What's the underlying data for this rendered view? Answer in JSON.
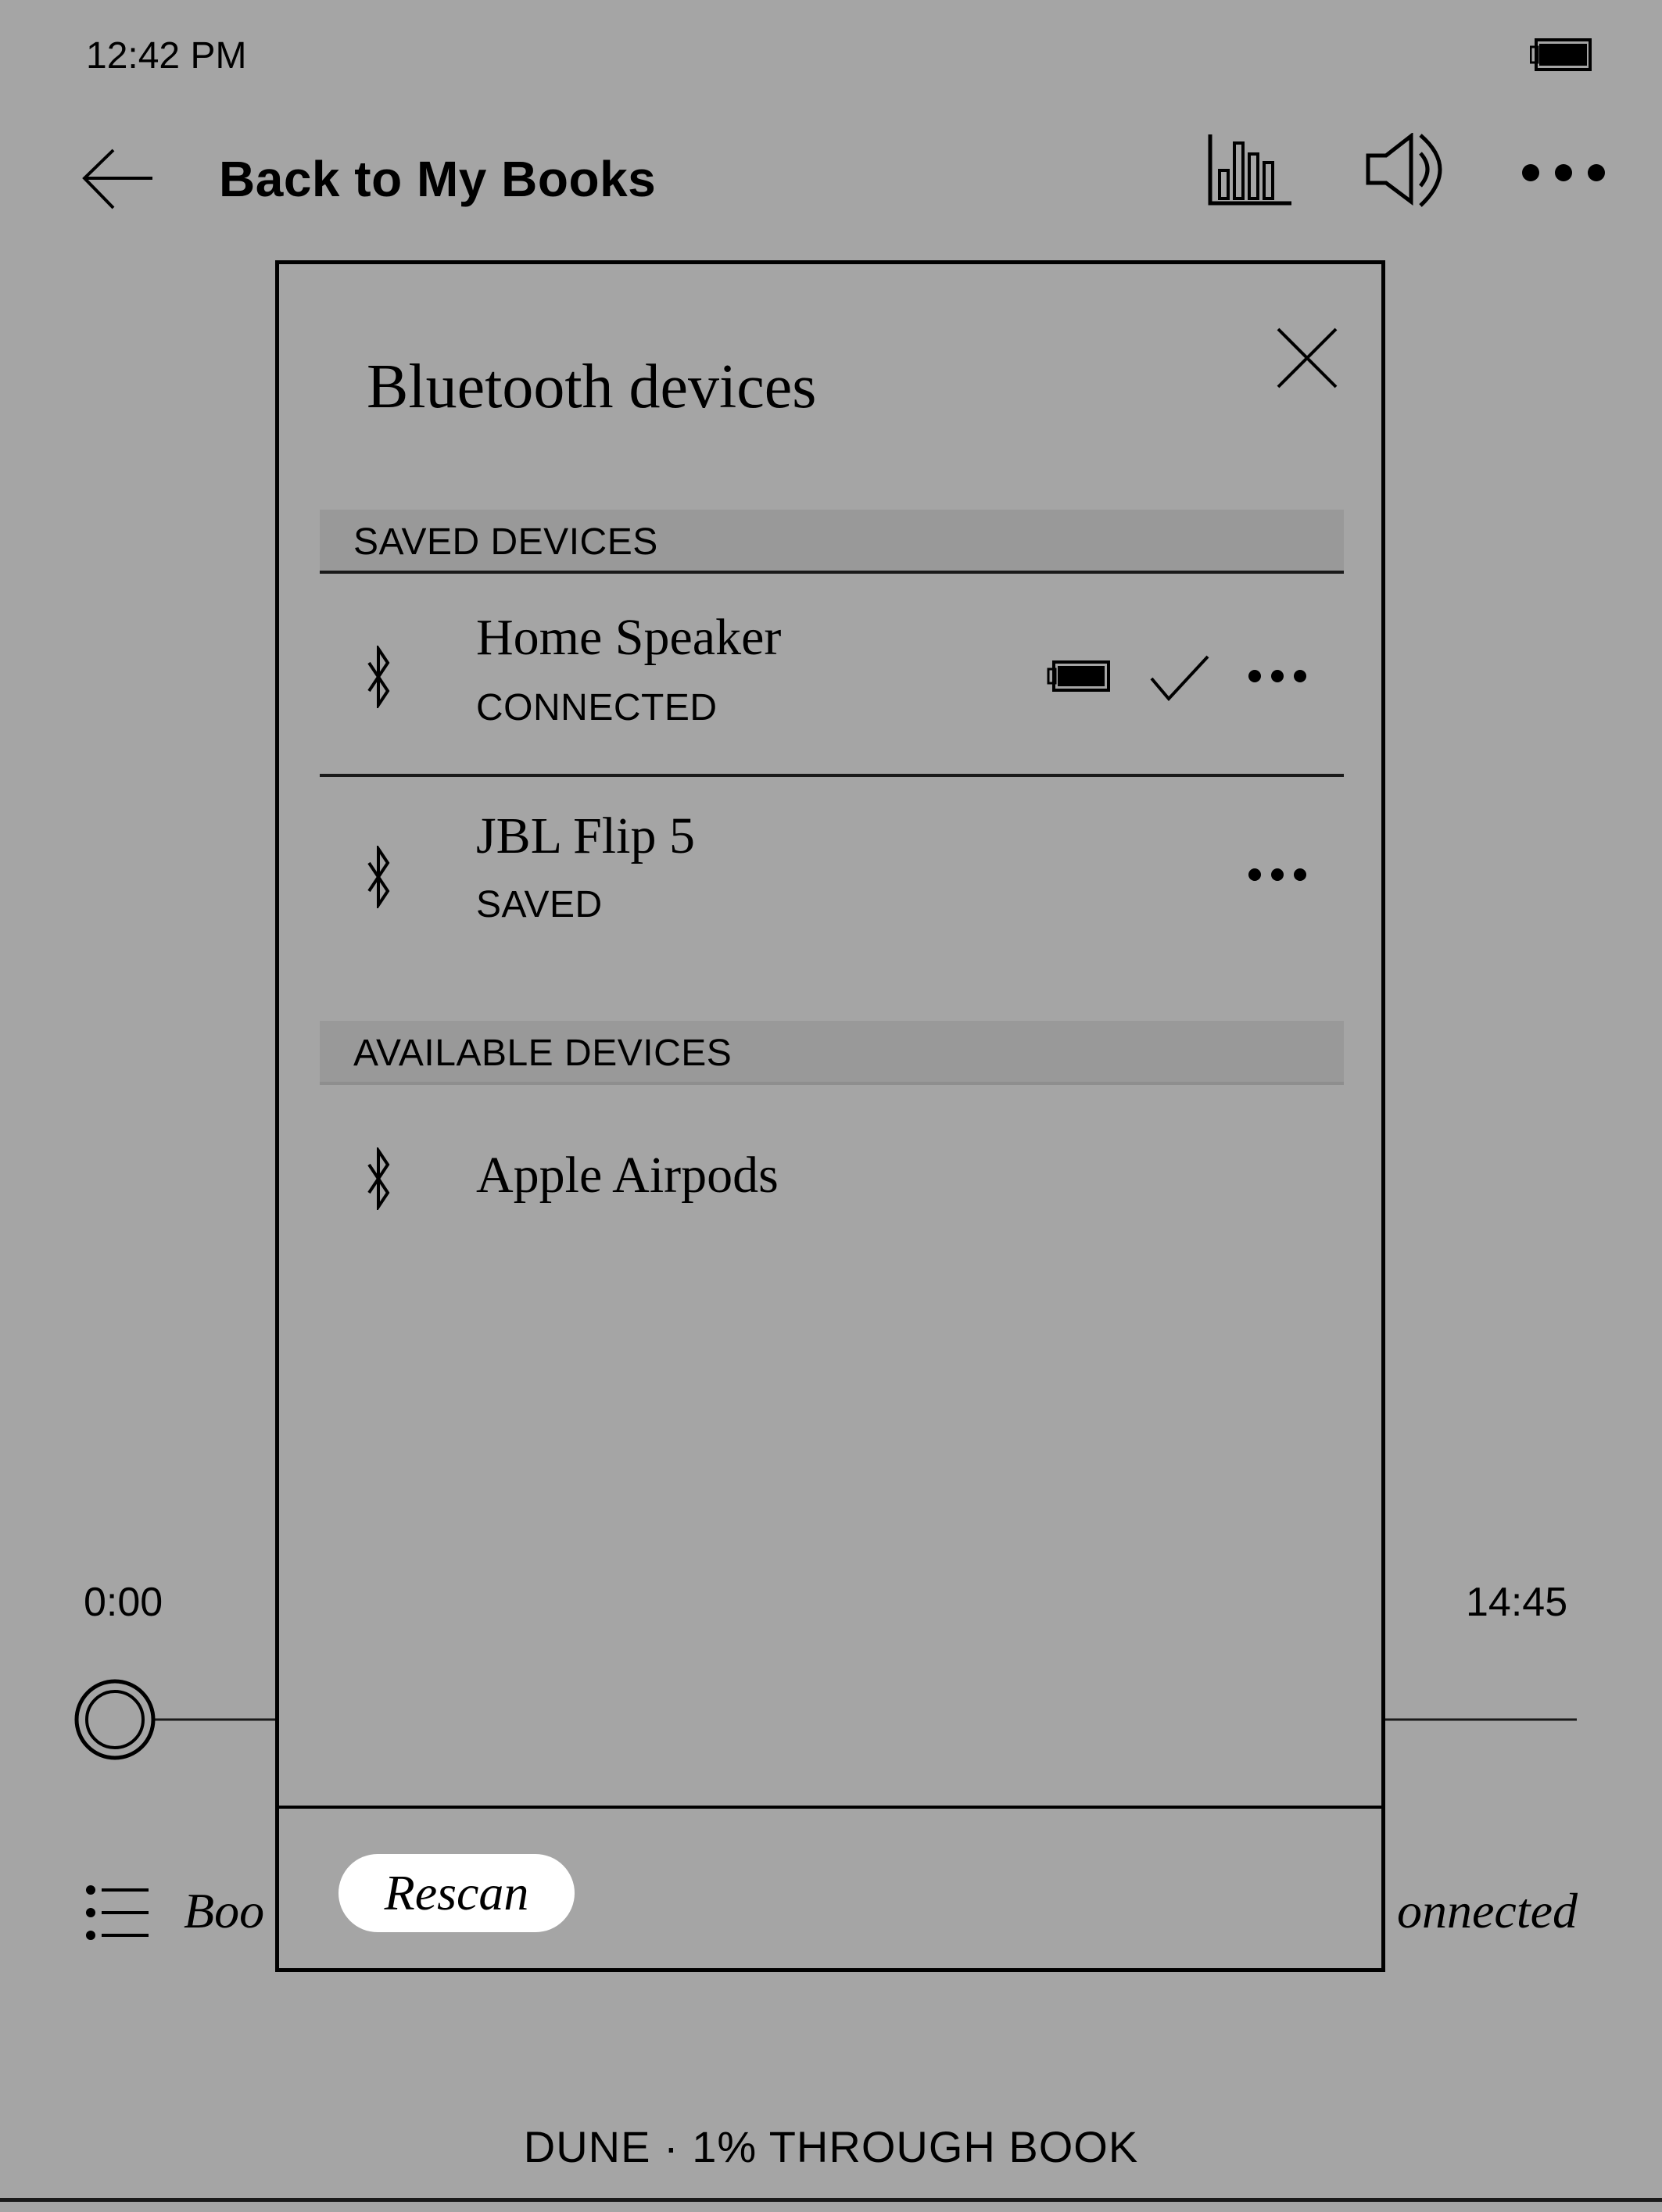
{
  "status_bar": {
    "time": "12:42 PM",
    "battery_icon": "battery-full-icon"
  },
  "header": {
    "back_icon": "arrow-left-icon",
    "back_label": "Back to My Books",
    "icons": [
      "bar-chart-icon",
      "volume-icon",
      "more-horizontal-icon"
    ]
  },
  "player": {
    "time_start": "0:00",
    "time_end": "14:45",
    "progress_fraction": 0.0,
    "toc_icon": "list-icon",
    "toc_label_visible": "Boo",
    "bluetooth_status_visible": "onnected"
  },
  "footer": {
    "book_progress": "DUNE · 1% THROUGH BOOK"
  },
  "dialog": {
    "title": "Bluetooth devices",
    "close_icon": "close-icon",
    "sections": [
      {
        "header": "SAVED DEVICES",
        "devices": [
          {
            "name": "Home Speaker",
            "status": "CONNECTED",
            "icon": "bluetooth-icon",
            "battery": "full",
            "connected": true,
            "has_menu": true
          },
          {
            "name": "JBL Flip 5",
            "status": "SAVED",
            "icon": "bluetooth-icon",
            "connected": false,
            "has_menu": true
          }
        ]
      },
      {
        "header": "AVAILABLE DEVICES",
        "devices": [
          {
            "name": "Apple Airpods",
            "icon": "bluetooth-icon"
          }
        ]
      }
    ],
    "rescan_label": "Rescan"
  }
}
